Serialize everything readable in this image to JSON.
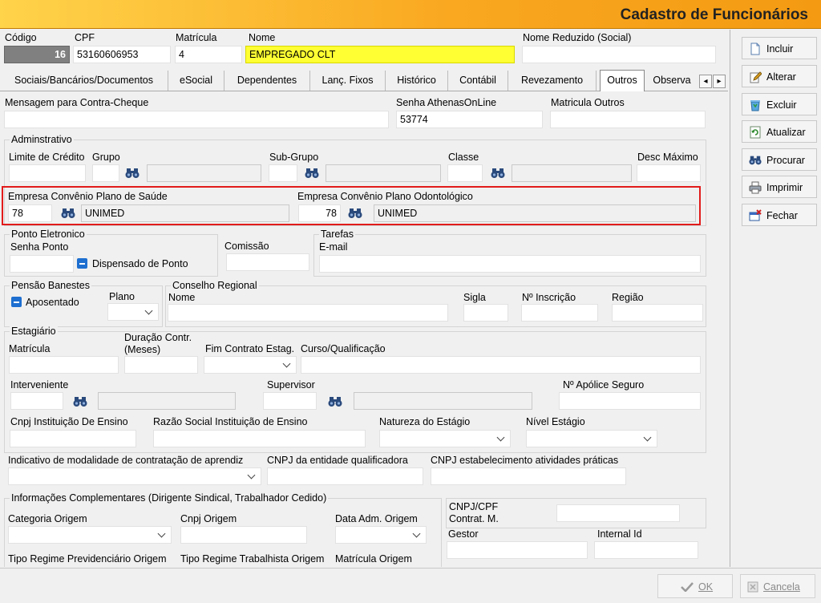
{
  "window": {
    "title": "Cadastro de Funcionários"
  },
  "header": {
    "codigo_label": "Código",
    "codigo_value": "16",
    "cpf_label": "CPF",
    "cpf_value": "53160606953",
    "matricula_label": "Matrícula",
    "matricula_value": "4",
    "nome_label": "Nome",
    "nome_value": "EMPREGADO CLT",
    "nome_reduzido_label": "Nome Reduzido (Social)",
    "nome_reduzido_value": ""
  },
  "tabs": [
    {
      "label": "Sociais/Bancários/Documentos"
    },
    {
      "label": "eSocial"
    },
    {
      "label": "Dependentes"
    },
    {
      "label": "Lanç. Fixos"
    },
    {
      "label": "Histórico"
    },
    {
      "label": "Contábil"
    },
    {
      "label": "Revezamento"
    },
    {
      "label": "Outros"
    },
    {
      "label": "Observa"
    }
  ],
  "tab_scroll": {
    "left": "◂",
    "right": "▸"
  },
  "outros": {
    "mensagem_label": "Mensagem para Contra-Cheque",
    "senha_athenas_label": "Senha AthenasOnLine",
    "senha_athenas_value": "53774",
    "matricula_outros_label": "Matricula Outros",
    "administrativo": {
      "title": "Adminstrativo",
      "limite_label": "Limite de Crédito",
      "grupo_label": "Grupo",
      "subgrupo_label": "Sub-Grupo",
      "classe_label": "Classe",
      "desc_max_label": "Desc Máximo"
    },
    "convenio": {
      "saude_label": "Empresa Convênio Plano de Saúde",
      "saude_code": "78",
      "saude_name": "UNIMED",
      "odonto_label": "Empresa Convênio Plano Odontológico",
      "odonto_code": "78",
      "odonto_name": "UNIMED"
    },
    "ponto": {
      "title": "Ponto Eletronico",
      "senha_label": "Senha Ponto",
      "dispensado_label": "Dispensado de Ponto",
      "comissao_label": "Comissão"
    },
    "tarefas": {
      "title": "Tarefas",
      "email_label": "E-mail"
    },
    "pensao": {
      "title": "Pensão Banestes",
      "aposentado_label": "Aposentado",
      "plano_label": "Plano"
    },
    "conselho": {
      "title": "Conselho Regional",
      "nome_label": "Nome",
      "sigla_label": "Sigla",
      "inscricao_label": "Nº Inscrição",
      "regiao_label": "Região"
    },
    "estagiario": {
      "title": "Estagiário",
      "matricula_label": "Matrícula",
      "duracao_label1": "Duração Contr.",
      "duracao_label2": "(Meses)",
      "fim_label": "Fim Contrato Estag.",
      "curso_label": "Curso/Qualificação",
      "interveniente_label": "Interveniente",
      "supervisor_label": "Supervisor",
      "apolice_label": "Nº Apólice Seguro",
      "cnpj_inst_label": "Cnpj Instituição De Ensino",
      "razao_label": "Razão Social Instituição de Ensino",
      "natureza_label": "Natureza do Estágio",
      "nivel_label": "Nível Estágio"
    },
    "aprendiz": {
      "modalidade_label": "Indicativo de modalidade de contratação de aprendiz",
      "cnpj_qual_label": "CNPJ da entidade qualificadora",
      "cnpj_estab_label": "CNPJ estabelecimento atividades práticas"
    },
    "complementares": {
      "title": "Informações Complementares (Dirigente Sindical, Trabalhador Cedido)",
      "categoria_label": "Categoria Origem",
      "cnpj_origem_label": "Cnpj Origem",
      "data_adm_label": "Data Adm. Origem",
      "tipo_prev_label": "Tipo Regime Previdenciário Origem",
      "tipo_trab_label": "Tipo Regime Trabalhista Origem",
      "matricula_origem_label": "Matrícula Origem"
    },
    "cnpj_cpf": {
      "label1": "CNPJ/CPF",
      "label2": "Contrat. M.",
      "gestor_label": "Gestor",
      "internal_id_label": "Internal Id"
    }
  },
  "sidebar": {
    "incluir": "Incluir",
    "alterar": "Alterar",
    "excluir": "Excluir",
    "atualizar": "Atualizar",
    "procurar": "Procurar",
    "imprimir": "Imprimir",
    "fechar": "Fechar"
  },
  "footer": {
    "ok": "OK",
    "cancela": "Cancela"
  }
}
